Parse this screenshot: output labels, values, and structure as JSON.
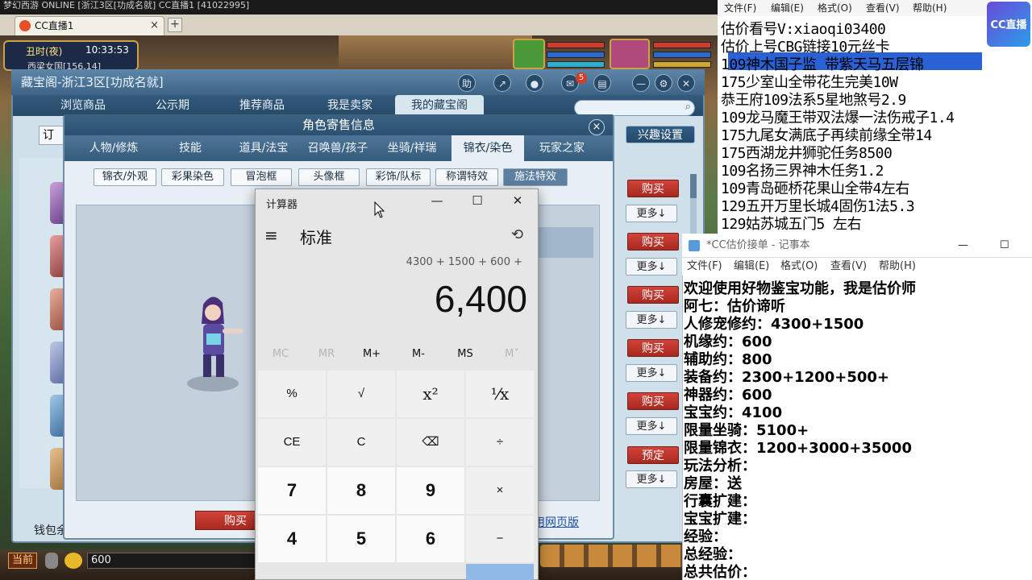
{
  "topstrip": {
    "text": "梦幻西游 ONLINE    [浙江3区[功成名就]    CC直播1 [41022995]"
  },
  "browser": {
    "tab_label": "CC直播1",
    "close": "×",
    "new_tab": "+"
  },
  "game": {
    "time_label": "丑时(夜)",
    "clock": "10:33:53",
    "location": "西梁女国[156,14]",
    "chat_channel": "当前",
    "chat_input": "600"
  },
  "cbg": {
    "title": "藏宝阁-浙江3区[功成名就]",
    "help": "助",
    "badge": "5",
    "nav": [
      "浏览商品",
      "公示期",
      "推荐商品",
      "我是卖家",
      "我的藏宝阁"
    ],
    "interest": "兴趣设置",
    "order_label": "订单",
    "buy": "购买",
    "more": "更多↓",
    "reserve": "预定",
    "wallet": "钱包余",
    "web_version": "用网页版"
  },
  "role": {
    "title": "角色寄售信息",
    "close": "×",
    "tabs": [
      "人物/修炼",
      "技能",
      "道具/法宝",
      "召唤兽/孩子",
      "坐骑/祥瑞",
      "锦衣/染色",
      "玩家之家"
    ],
    "subtabs": [
      "锦衣/外观",
      "彩果染色",
      "冒泡框",
      "头像框",
      "彩饰/队标",
      "称谓特效",
      "施法特效"
    ],
    "buy": "购买"
  },
  "calc": {
    "title": "计算器",
    "min": "—",
    "max": "☐",
    "close": "✕",
    "menu": "≡",
    "mode": "标准",
    "history": "⟲",
    "expression": "4300 + 1500 + 600 +",
    "display": "6,400",
    "memory": [
      "MC",
      "MR",
      "M+",
      "M-",
      "MS",
      "M˅"
    ],
    "keys": [
      "%",
      "√",
      "x²",
      "⅟x",
      "CE",
      "C",
      "⌫",
      "÷",
      "7",
      "8",
      "9",
      "×",
      "4",
      "5",
      "6",
      "−"
    ]
  },
  "notepad1": {
    "menu": [
      "文件(F)",
      "编辑(E)",
      "格式(O)",
      "查看(V)",
      "帮助(H)"
    ],
    "lines": [
      "估价看号V:xiaoqi03400",
      "估价上号CBG链接10元丝卡",
      "109神木国子监 带紫天马五层锦",
      "175少室山全带花生完美10W",
      "恭王府109法系5星地煞号2.9",
      "109龙马魔王带双法爆一法伤戒子1.4",
      "175九尾女满底子再续前缘全带14",
      "175西湖龙井狮驼任务8500",
      "109名扬三界神木任务1.2",
      "109青岛砸桥花果山全带4左右",
      "129五开万里长城4固伤1法5.3",
      "129姑苏城五门5 左右"
    ],
    "logo": "CC直播"
  },
  "notepad2": {
    "title": "*CC估价接单 - 记事本",
    "min": "—",
    "max": "☐",
    "menu": [
      "文件(F)",
      "编辑(E)",
      "格式(O)",
      "查看(V)",
      "帮助(H)"
    ],
    "lines": [
      "欢迎使用好物鉴宝功能，我是估价师",
      "阿七：估价谛听",
      "人修宠修约：4300+1500",
      "机缘约：600",
      "辅助约：800",
      "装备约：2300+1200+500+",
      "神器约：600",
      "宝宝约：4100",
      "限量坐骑：5100+",
      "限量锦衣：1200+3000+35000",
      "玩法分析：",
      "房屋：送",
      "行囊扩建：",
      "宝宝扩建：",
      "经验：",
      "总经验：",
      "总共估价："
    ]
  }
}
